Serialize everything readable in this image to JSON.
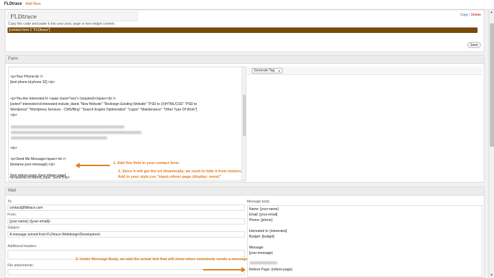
{
  "topbar": {
    "title": "FLDtrace",
    "add_new": "Add New"
  },
  "form_header": {
    "title": "FLDtrace",
    "copy": "Copy",
    "separator": "|",
    "delete": "Delete",
    "instructions": "Copy this code and paste it into your post, page or text widget content.",
    "shortcode": "[contact-form 2 \"FLDtrace\"]",
    "save": "Save"
  },
  "form_panel": {
    "heading": "Form",
    "generate_tag": "Generate Tag",
    "code_lines": [
      "<p>Your Phone<br />",
      "    [text phone id:phone 32] </p>",
      "<p>You Are Interested In <span class=\"req\"> (required)</span><br />",
      "    [select*  interested id:interested include_blank \"New Website\" \"Redesign Existing Website\" \"PSD to (X)HTML/CSS\" \"PSD to",
      "Wordpress\" \"Wordpress Services - CMS/Blog\" \"Search Engine Optimization\" \"Logos\" \"Maintenance\" \"Other Type Of Work\"]",
      "</p>",
      "</p>",
      "<p>Send Me Message</span><br />",
      "    [textarea your-message] </p>",
      "[text referer-page class:referer-page]",
      "<p>[submit id:submit_input \"Send\"]</p>"
    ]
  },
  "annotations": {
    "step1": "1. Add this field in your contact form.",
    "step2a": "2. Since it will get the url dinamically, we need to hide it from visitors.",
    "step2b": "Add in your style.css \"input.referer-page {display: none}\"",
    "step3": "3. Under Message Body, we add the actual link that will show when somebody sends a message"
  },
  "mail_panel": {
    "heading": "Mail",
    "to_label": "To:",
    "to_value": "contact@fldtrace.com",
    "from_label": "From:",
    "from_value": "[your-name] <[your-email]>",
    "subject_label": "Subject:",
    "subject_value": "A message arrived from FLDtrace Webdesign/Development",
    "headers_label": "Additional headers:",
    "attachments_label": "File attachments:",
    "body_label": "Message body:",
    "body_lines": [
      "Name: [your-name]",
      "Email: [your-email]",
      "Phone: [phone]",
      "Interested in: [interested]",
      "Budget: [budget]",
      "Message:",
      "[your-message]",
      "Referer Page: [referer-page]"
    ]
  },
  "colors": {
    "accent_orange": "#e07b1b",
    "shortcode_bg": "#7b4a0a",
    "link_blue": "#21759b",
    "delete_red": "#bc0b0b"
  },
  "icons": {
    "scroll_up": "chevron-up-icon",
    "scroll_down": "chevron-down-icon",
    "dropdown": "caret-down-icon"
  }
}
